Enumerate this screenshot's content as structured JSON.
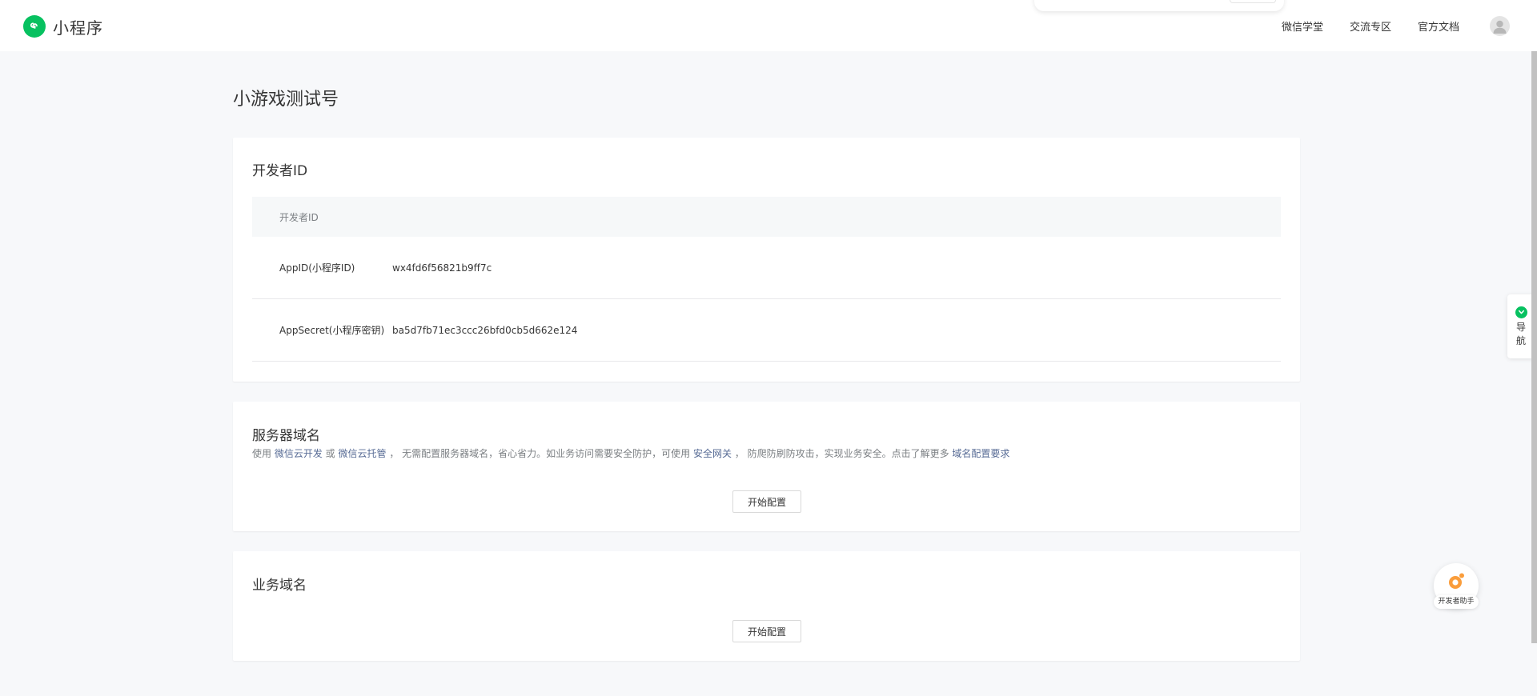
{
  "header": {
    "brand_name": "小程序",
    "nav": [
      "微信学堂",
      "交流专区",
      "官方文档"
    ]
  },
  "page": {
    "title": "小游戏测试号"
  },
  "developer_id": {
    "title": "开发者ID",
    "table_header": "开发者ID",
    "rows": [
      {
        "label": "AppID(小程序ID)",
        "value": "wx4fd6f56821b9ff7c"
      },
      {
        "label": "AppSecret(小程序密钥)",
        "value": "ba5d7fb71ec3ccc26bfd0cb5d662e124"
      }
    ]
  },
  "server_domain": {
    "title": "服务器域名",
    "desc": {
      "t1": "使用 ",
      "link1": "微信云开发",
      "t2": " 或 ",
      "link2": "微信云托管",
      "t3": " ， 无需配置服务器域名，省心省力。如业务访问需要安全防护，可使用 ",
      "link3": "安全网关",
      "t4": " ， 防爬防刷防攻击，实现业务安全。点击了解更多 ",
      "link4": "域名配置要求"
    },
    "button": "开始配置"
  },
  "business_domain": {
    "title": "业务域名",
    "button": "开始配置"
  },
  "floating": {
    "side_nav_text": "导航",
    "helper_label": "开发者助手"
  },
  "colors": {
    "brand_green": "#07c160",
    "link_blue": "#576b95",
    "helper_orange": "#fa9d3b"
  }
}
